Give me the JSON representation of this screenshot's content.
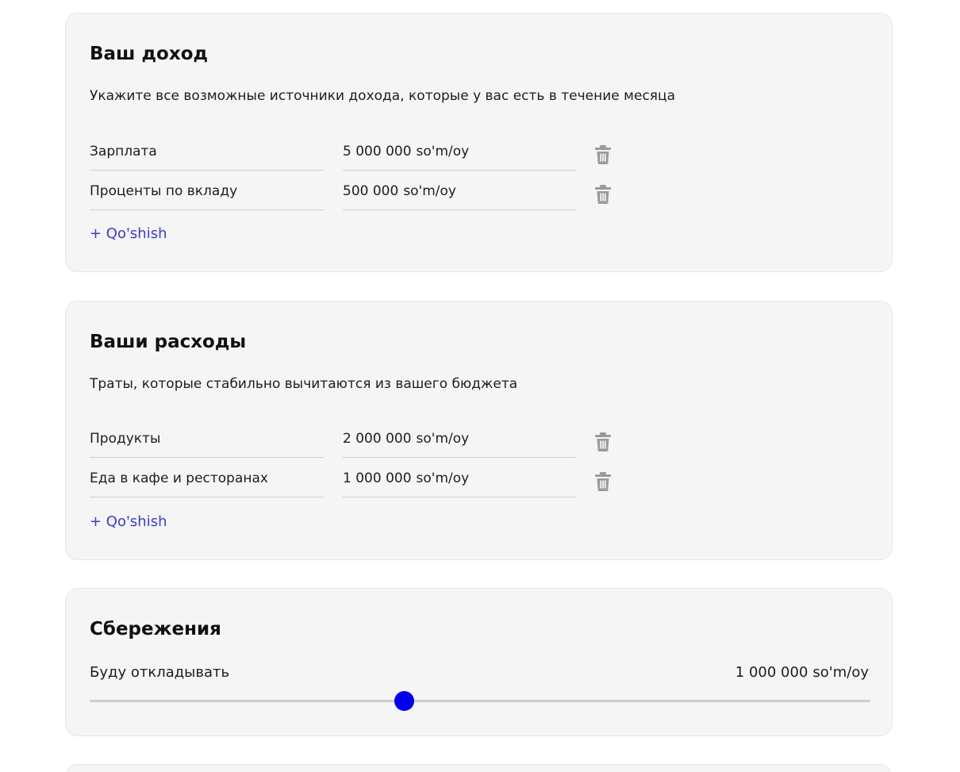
{
  "income": {
    "title": "Ваш доход",
    "description": "Укажите все возможные источники дохода, которые у вас есть в течение месяца",
    "items": [
      {
        "name": "Зарплата",
        "amount": "5 000 000",
        "unit": "so'm/oy"
      },
      {
        "name": "Проценты по вкладу",
        "amount": "500 000",
        "unit": "so'm/oy"
      }
    ],
    "add_label": "+ Qo'shish"
  },
  "expenses": {
    "title": "Ваши расходы",
    "description": "Траты, которые стабильно вычитаются из вашего бюджета",
    "items": [
      {
        "name": "Продукты",
        "amount": "2 000 000",
        "unit": "so'm/oy"
      },
      {
        "name": "Еда в кафе и ресторанах",
        "amount": "1 000 000",
        "unit": "so'm/oy"
      }
    ],
    "add_label": "+ Qo'shish"
  },
  "savings": {
    "title": "Сбережения",
    "label": "Буду откладывать",
    "amount": "1 000 000",
    "unit": "so'm/oy",
    "slider_fraction": 0.403
  },
  "icons": {
    "delete": "trash-icon"
  },
  "colors": {
    "accent_link": "#3a3cc8",
    "slider_thumb": "#0000ee",
    "card_background": "#f5f5f5",
    "icon_gray": "#9a9a9a"
  }
}
